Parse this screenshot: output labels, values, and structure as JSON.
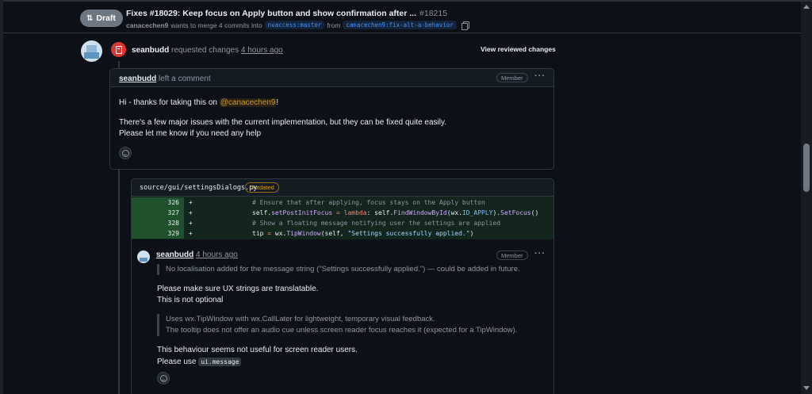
{
  "header": {
    "draft_label": "Draft",
    "title": "Fixes #18029: Keep focus on Apply button and show confirmation after ...",
    "number": "#18215",
    "author": "canacechen9",
    "merge_text_1": "wants to merge 4 commits into",
    "base_branch": "nvaccess:master",
    "merge_text_2": "from",
    "head_branch": "canacechen9:fix-alt-a-behavior"
  },
  "review": {
    "user": "seanbudd",
    "action": "requested changes",
    "time": "4 hours ago",
    "view_changes_label": "View reviewed changes"
  },
  "comment": {
    "user": "seanbudd",
    "action": "left a comment",
    "role": "Member",
    "line1_prefix": "Hi - thanks for taking this on ",
    "mention": "@canacechen9",
    "line1_suffix": "!",
    "line2": "There's a few major issues with the current implementation, but they can be fixed quite easily.",
    "line3": "Please let me know if you need any help"
  },
  "thread": {
    "file_path": "source/gui/settingsDialogs.py",
    "outdated_label": "Outdated",
    "diff": [
      {
        "num": "326",
        "sign": "+",
        "code": "# Ensure that after applying, focus stays on the Apply button"
      },
      {
        "num": "327",
        "sign": "+",
        "code": "self.setPostInitFocus = lambda: self.FindWindowById(wx.ID_APPLY).SetFocus()"
      },
      {
        "num": "328",
        "sign": "+",
        "code": "# Show a floating message notifying user the settings are applied"
      },
      {
        "num": "329",
        "sign": "+",
        "code": "tip = wx.TipWindow(self, \"Settings successfully applied.\")"
      }
    ],
    "reply": {
      "user": "seanbudd",
      "time": "4 hours ago",
      "role": "Member",
      "quote1": "No localisation added for the message string (\"Settings successfully applied.\") — could be added in future.",
      "text1": "Please make sure UX strings are translatable.",
      "text2": "This is not optional",
      "quote2_line1": "Uses wx.TipWindow with wx.CallLater for lightweight, temporary visual feedback.",
      "quote2_line2": "The tooltip does not offer an audio cue unless screen reader focus reaches it (expected for a TipWindow).",
      "text3": "This behaviour seems not useful for screen reader users.",
      "text4_prefix": "Please use ",
      "text4_code": "ui.message"
    }
  },
  "icons": {
    "draft": "git-pull-request-draft-icon",
    "changes_requested": "file-diff-icon",
    "copy": "copy-icon",
    "kebab": "kebab-horizontal-icon",
    "emoji": "smiley-icon"
  },
  "colors": {
    "background": "#0d1117",
    "changes_requested": "#da3633",
    "mention": "#d29922",
    "branch": "#4493f8",
    "diff_add": "#2ea043"
  }
}
